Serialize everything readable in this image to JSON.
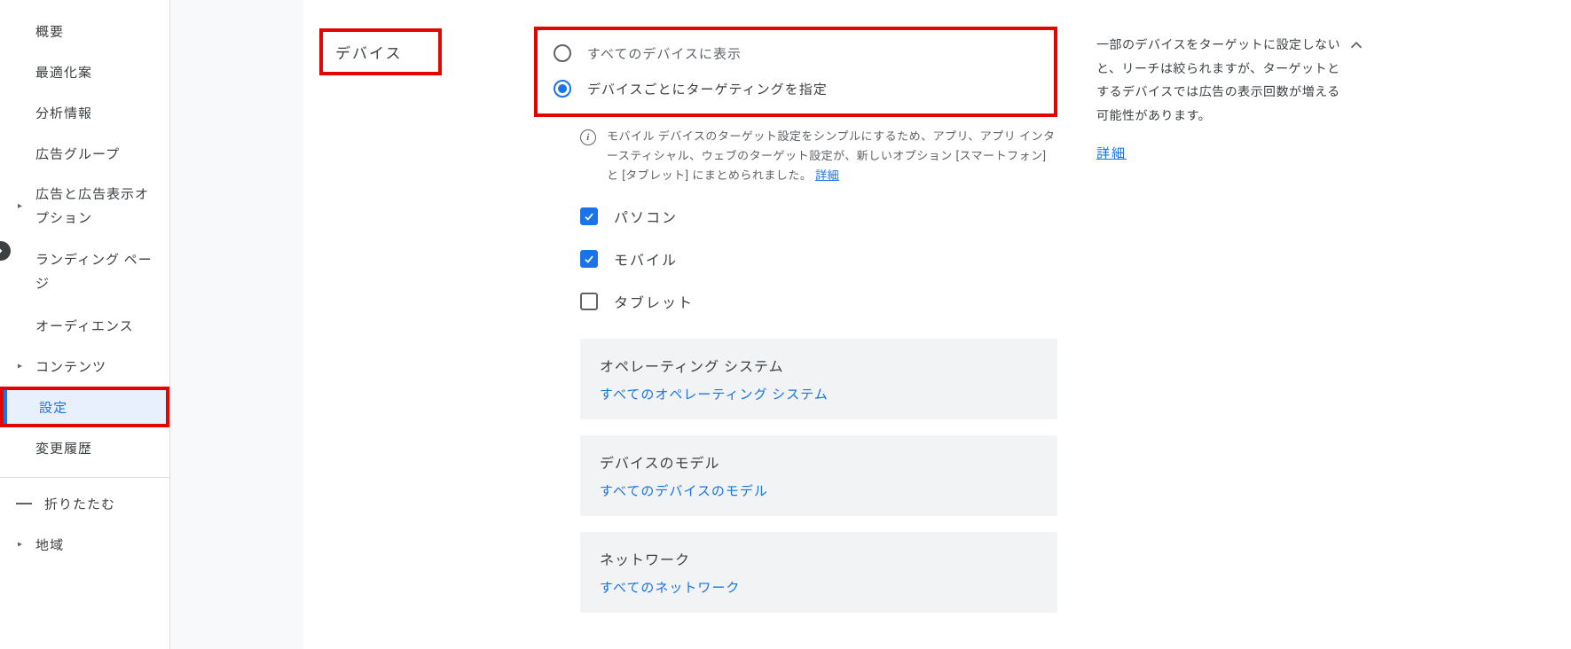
{
  "sidebar": {
    "items": [
      {
        "label": "概要",
        "hasChevron": false
      },
      {
        "label": "最適化案",
        "hasChevron": false
      },
      {
        "label": "分析情報",
        "hasChevron": false
      },
      {
        "label": "広告グループ",
        "hasChevron": false
      },
      {
        "label": "広告と広告表示オプション",
        "hasChevron": true,
        "multiline": true
      },
      {
        "label": "ランディング ページ",
        "hasChevron": false,
        "multiline": true
      },
      {
        "label": "オーディエンス",
        "hasChevron": false
      },
      {
        "label": "コンテンツ",
        "hasChevron": true
      },
      {
        "label": "設定",
        "hasChevron": false,
        "active": true,
        "highlight": true
      },
      {
        "label": "変更履歴",
        "hasChevron": false
      }
    ],
    "collapse_label": "折りたたむ",
    "extra_item": {
      "label": "地域",
      "hasChevron": true
    }
  },
  "device": {
    "section_title": "デバイス",
    "radio_all_label": "すべてのデバイスに表示",
    "radio_specific_label": "デバイスごとにターゲティングを指定",
    "info_text": "モバイル デバイスのターゲット設定をシンプルにするため、アプリ、アプリ インタースティシャル、ウェブのターゲット設定が、新しいオプション [スマートフォン] と [タブレット] にまとめられました。 ",
    "info_link": "詳細",
    "checks": [
      {
        "label": "パソコン",
        "checked": true
      },
      {
        "label": "モバイル",
        "checked": true
      },
      {
        "label": "タブレット",
        "checked": false
      }
    ],
    "subpanels": [
      {
        "title": "オペレーティング システム",
        "value": "すべてのオペレーティング システム"
      },
      {
        "title": "デバイスのモデル",
        "value": "すべてのデバイスのモデル"
      },
      {
        "title": "ネットワーク",
        "value": "すべてのネットワーク"
      }
    ]
  },
  "helper": {
    "text": "一部のデバイスをターゲットに設定しないと、リーチは絞られますが、ターゲットとするデバイスでは広告の表示回数が増える可能性があります。",
    "link": "詳細"
  }
}
